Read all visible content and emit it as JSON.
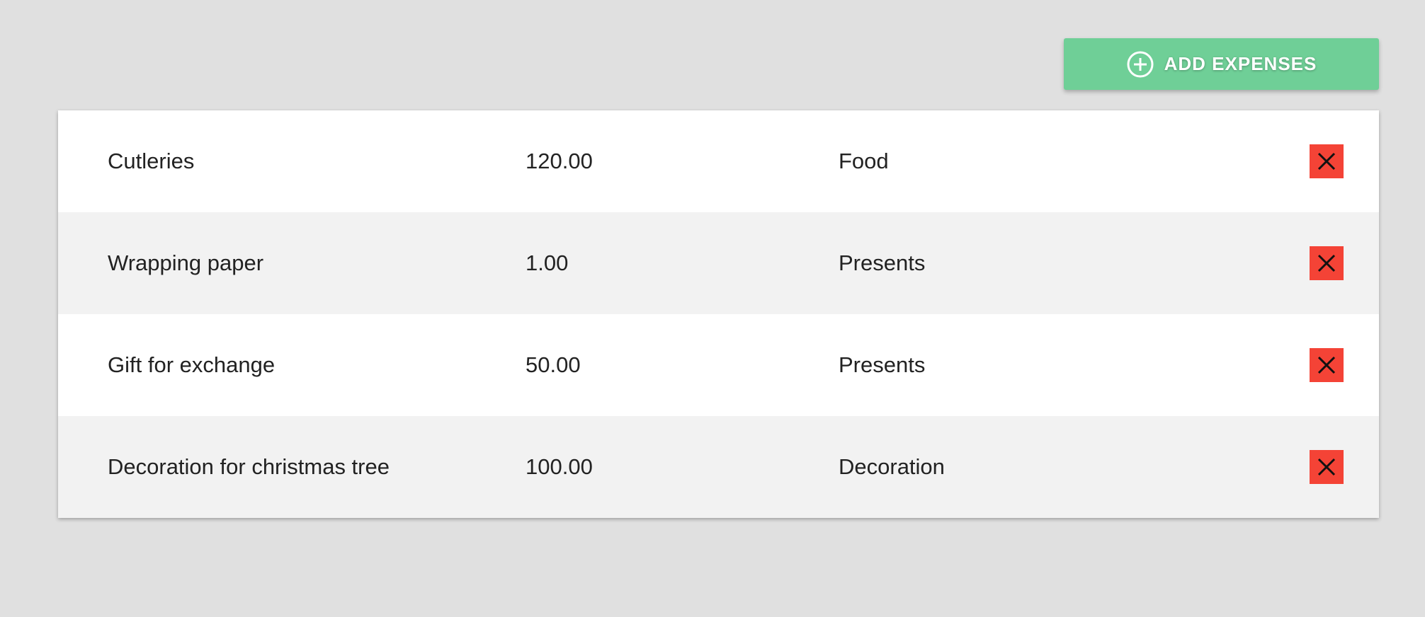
{
  "toolbar": {
    "add_label": "ADD EXPENSES",
    "add_icon": "plus-circle-icon",
    "add_color": "#6fcf97"
  },
  "expenses": [
    {
      "description": "Cutleries",
      "amount": "120.00",
      "category": "Food"
    },
    {
      "description": "Wrapping paper",
      "amount": "1.00",
      "category": "Presents"
    },
    {
      "description": "Gift for exchange",
      "amount": "50.00",
      "category": "Presents"
    },
    {
      "description": "Decoration for christmas tree",
      "amount": "100.00",
      "category": "Decoration"
    }
  ],
  "delete_icon": "close-icon",
  "delete_color": "#f44336"
}
